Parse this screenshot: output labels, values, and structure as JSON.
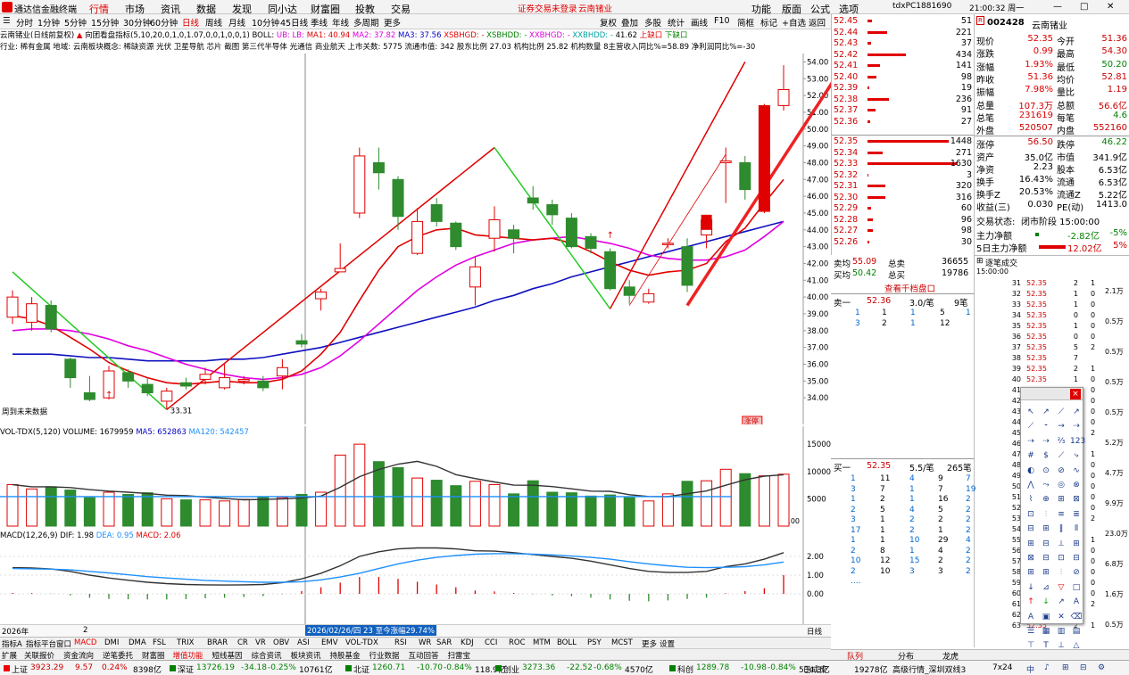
{
  "app": {
    "title": "通达信金融终端",
    "status_red": "证券交易未登录",
    "status_stock": "云南锗业",
    "user": "tdxPC1881690",
    "time": "21:00:32 周一"
  },
  "menu": [
    "行情",
    "市场",
    "资讯",
    "数据",
    "发现",
    "同小达",
    "财富圈",
    "投教",
    "交易"
  ],
  "right_menu": [
    "功能",
    "版面",
    "公式",
    "选项"
  ],
  "periods": [
    "分时",
    "1分钟",
    "5分钟",
    "15分钟",
    "30分钟",
    "60分钟",
    "日线",
    "周线",
    "月线",
    "10分钟",
    "45日线",
    "季线",
    "年线",
    "多周期",
    "更多"
  ],
  "period_tools": [
    "复权",
    "叠加",
    "多股",
    "统计",
    "画线",
    "F10",
    "简框",
    "标记",
    "+自选",
    "返回"
  ],
  "legend": {
    "main": "云南锗业(日线前复权)",
    "formula": "向团看盘指标(5,10,20,0,1,0,1.07,0,0,1,0,0,1)",
    "boll": "BOLL:",
    "ub": "UB:",
    "lb": "LB:",
    "ma1": "MA1: 40.94",
    "ma2": "MA2: 37.82",
    "ma3": "MA3: 37.56",
    "xsbhgd": "XSBHGD: -",
    "xsbhdd": "XSBHDD: -",
    "xxbhgd": "XXBHGD: -",
    "xxbhdd": "XXBHDD: -",
    "val": "41.62",
    "up": "上缺口",
    "down": "下缺口"
  },
  "industry_line": "行业: 稀有金属 地域: 云南板块概念: 稀缺资源 光伏 卫星导航 芯片 截图 第三代半导体 光通信 商业航天 上市关数: 5775 流通市值: 342 股东比例 27.03 机构比例 25.82 机构数量 8主营收入同比%=58.89 净利润同比%=-30",
  "price_axis": [
    "54.00",
    "53.00",
    "52.00",
    "51.00",
    "50.00",
    "49.00",
    "48.00",
    "47.00",
    "46.00",
    "45.00",
    "44.00",
    "43.00",
    "42.00",
    "41.00",
    "40.00",
    "39.00",
    "38.00",
    "37.00",
    "36.00",
    "35.00",
    "34.00"
  ],
  "price_labels": {
    "low": "33.31",
    "note": "周到未来数据",
    "tag": "涨停"
  },
  "vol": {
    "title": "VOL-TDX(5,120)",
    "volume": "VOLUME: 1679959",
    "ma5": "MA5: 652863",
    "ma120": "MA120: 542457",
    "unit": "X100",
    "axis": [
      "15000",
      "10000",
      "5000"
    ]
  },
  "macd": {
    "title": "MACD(12,26,9)",
    "dif": "DIF: 1.98",
    "dea": "DEA: 0.95",
    "macd": "MACD: 2.06",
    "axis": [
      "2.00",
      "1.00",
      "0.00"
    ]
  },
  "date_axis": {
    "year": "2026年",
    "m2": "2",
    "tip": "2026/02/26/四 23 至今涨幅29.74%",
    "tab": "日线"
  },
  "chart_data": {
    "type": "candlestick",
    "ylim": [
      33,
      54.5
    ],
    "candles": [
      {
        "o": 38.8,
        "c": 40.0,
        "h": 40.4,
        "l": 38.4
      },
      {
        "o": 38.5,
        "c": 39.6,
        "h": 40.0,
        "l": 38.0
      },
      {
        "o": 39.5,
        "c": 38.1,
        "h": 39.8,
        "l": 37.9
      },
      {
        "o": 36.3,
        "c": 35.2,
        "h": 36.4,
        "l": 34.6
      },
      {
        "o": 34.3,
        "c": 33.9,
        "h": 35.3,
        "l": 33.8
      },
      {
        "o": 34.0,
        "c": 35.6,
        "h": 35.9,
        "l": 33.9
      },
      {
        "o": 35.5,
        "c": 35.0,
        "h": 35.7,
        "l": 34.6
      },
      {
        "o": 34.8,
        "c": 34.3,
        "h": 35.2,
        "l": 34.1
      },
      {
        "o": 33.8,
        "c": 34.4,
        "h": 34.6,
        "l": 33.3
      },
      {
        "o": 34.9,
        "c": 34.7,
        "h": 35.2,
        "l": 34.5
      },
      {
        "o": 35.1,
        "c": 35.4,
        "h": 35.8,
        "l": 34.8
      },
      {
        "o": 34.6,
        "c": 35.2,
        "h": 36.0,
        "l": 34.5
      },
      {
        "o": 35.0,
        "c": 35.1,
        "h": 35.3,
        "l": 34.8
      },
      {
        "o": 35.0,
        "c": 34.6,
        "h": 35.3,
        "l": 34.4
      },
      {
        "o": 35.3,
        "c": 35.8,
        "h": 36.3,
        "l": 34.5
      },
      {
        "o": 37.4,
        "c": 37.2,
        "h": 37.8,
        "l": 37.0
      },
      {
        "o": 39.9,
        "c": 40.3,
        "h": 40.5,
        "l": 39.2
      },
      {
        "o": 41.5,
        "c": 41.7,
        "h": 43.2,
        "l": 41.5
      },
      {
        "o": 45.0,
        "c": 48.4,
        "h": 48.9,
        "l": 44.7
      },
      {
        "o": 48.0,
        "c": 47.4,
        "h": 48.9,
        "l": 46.4
      },
      {
        "o": 47.0,
        "c": 44.8,
        "h": 47.2,
        "l": 44.0
      },
      {
        "o": 42.6,
        "c": 44.5,
        "h": 45.3,
        "l": 42.5
      },
      {
        "o": 45.5,
        "c": 44.5,
        "h": 45.9,
        "l": 44.2
      },
      {
        "o": 44.4,
        "c": 43.0,
        "h": 44.5,
        "l": 42.8
      },
      {
        "o": 40.6,
        "c": 41.8,
        "h": 42.4,
        "l": 39.5
      },
      {
        "o": 43.5,
        "c": 44.6,
        "h": 45.4,
        "l": 42.7
      },
      {
        "o": 44.0,
        "c": 43.5,
        "h": 44.3,
        "l": 42.6
      },
      {
        "o": 45.9,
        "c": 45.6,
        "h": 46.6,
        "l": 45.2
      },
      {
        "o": 45.5,
        "c": 44.9,
        "h": 45.8,
        "l": 44.3
      },
      {
        "o": 44.7,
        "c": 43.0,
        "h": 45.0,
        "l": 42.9
      },
      {
        "o": 43.6,
        "c": 42.9,
        "h": 43.8,
        "l": 42.6
      },
      {
        "o": 42.7,
        "c": 40.5,
        "h": 42.9,
        "l": 40.4
      },
      {
        "o": 40.6,
        "c": 40.1,
        "h": 41.0,
        "l": 39.6
      },
      {
        "o": 39.7,
        "c": 40.2,
        "h": 40.5,
        "l": 39.6
      },
      {
        "o": 43.2,
        "c": 43.2,
        "h": 43.5,
        "l": 42.9
      },
      {
        "o": 43.0,
        "c": 40.7,
        "h": 43.5,
        "l": 40.3
      },
      {
        "o": 43.7,
        "c": 44.6,
        "h": 44.9,
        "l": 42.9
      },
      {
        "o": 48.0,
        "c": 48.1,
        "h": 48.9,
        "l": 45.6
      },
      {
        "o": 48.0,
        "c": 46.4,
        "h": 48.4,
        "l": 45.8
      },
      {
        "o": 45.1,
        "c": 51.4,
        "h": 51.5,
        "l": 45.0
      },
      {
        "o": 51.4,
        "c": 52.35,
        "h": 53.8,
        "l": 51.1
      }
    ],
    "ma1": [
      38.9,
      38.7,
      38.3,
      37.6,
      36.9,
      36.1,
      35.6,
      35.2,
      34.9,
      34.8,
      34.9,
      35.0,
      34.9,
      34.9,
      35.1,
      35.6,
      36.6,
      37.9,
      39.8,
      41.6,
      43.0,
      43.6,
      44.0,
      44.1,
      43.7,
      43.6,
      43.5,
      43.4,
      43.5,
      43.2,
      42.7,
      42.1,
      41.6,
      41.3,
      41.5,
      41.6,
      42.0,
      43.3,
      44.1,
      45.6,
      47.0
    ],
    "ma2": [
      38.0,
      38.1,
      38.1,
      38.0,
      37.8,
      37.5,
      37.1,
      36.8,
      36.4,
      36.0,
      35.7,
      35.4,
      35.2,
      35.1,
      35.2,
      35.4,
      35.8,
      36.5,
      37.4,
      38.4,
      39.4,
      40.4,
      41.2,
      41.9,
      42.4,
      42.8,
      43.2,
      43.4,
      43.5,
      43.6,
      43.4,
      43.2,
      42.9,
      42.5,
      42.3,
      42.2,
      42.2,
      42.4,
      42.8,
      43.6,
      44.5
    ],
    "ma3": [
      36.6,
      36.6,
      36.6,
      36.5,
      36.4,
      36.4,
      36.3,
      36.2,
      36.2,
      36.2,
      36.2,
      36.3,
      36.3,
      36.4,
      36.6,
      36.8,
      37.0,
      37.3,
      37.6,
      37.9,
      38.2,
      38.5,
      38.8,
      39.1,
      39.4,
      39.8,
      40.1,
      40.5,
      40.8,
      41.2,
      41.5,
      41.8,
      42.1,
      42.4,
      42.7,
      43.0,
      43.3,
      43.6,
      43.9,
      44.2,
      44.5
    ],
    "volumes": [
      7600,
      6800,
      7200,
      6600,
      5200,
      6200,
      5800,
      6100,
      5000,
      4800,
      4800,
      4600,
      4900,
      5300,
      5200,
      5800,
      6200,
      13000,
      15000,
      11800,
      10700,
      8800,
      8400,
      7400,
      8200,
      7600,
      5900,
      8300,
      6200,
      6100,
      5500,
      5700,
      5200,
      4600,
      5900,
      8200,
      8300,
      10400,
      9600,
      9200,
      9500
    ],
    "macd_dif": [
      1.4,
      1.38,
      1.33,
      1.2,
      1.0,
      0.85,
      0.73,
      0.62,
      0.55,
      0.5,
      0.48,
      0.47,
      0.48,
      0.5,
      0.6,
      0.8,
      1.1,
      1.5,
      2.0,
      2.25,
      2.4,
      2.45,
      2.45,
      2.4,
      2.3,
      2.28,
      2.2,
      2.1,
      2.0,
      1.9,
      1.75,
      1.55,
      1.35,
      1.2,
      1.15,
      1.15,
      1.2,
      1.45,
      1.6,
      1.85,
      2.2
    ],
    "macd_dea": [
      1.35,
      1.34,
      1.32,
      1.28,
      1.2,
      1.12,
      1.02,
      0.92,
      0.85,
      0.78,
      0.72,
      0.68,
      0.65,
      0.62,
      0.62,
      0.65,
      0.75,
      0.9,
      1.1,
      1.35,
      1.6,
      1.8,
      1.95,
      2.05,
      2.12,
      2.15,
      2.15,
      2.12,
      2.08,
      2.02,
      1.95,
      1.85,
      1.72,
      1.6,
      1.5,
      1.42,
      1.4,
      1.42,
      1.45,
      1.55,
      1.7
    ],
    "macd_hist": [
      0.05,
      0.04,
      0.01,
      -0.08,
      -0.2,
      -0.27,
      -0.29,
      -0.3,
      -0.3,
      -0.28,
      -0.24,
      -0.21,
      -0.17,
      -0.12,
      -0.02,
      0.15,
      0.35,
      0.6,
      0.9,
      0.9,
      0.8,
      0.65,
      0.5,
      0.35,
      0.18,
      0.13,
      0.05,
      -0.02,
      -0.08,
      -0.12,
      -0.2,
      -0.3,
      -0.37,
      -0.4,
      -0.35,
      -0.27,
      -0.2,
      0.03,
      0.15,
      0.3,
      1.0
    ]
  },
  "order_book": {
    "asks": [
      [
        "52.45",
        "51"
      ],
      [
        "52.44",
        "221"
      ],
      [
        "52.43",
        "37"
      ],
      [
        "52.42",
        "434"
      ],
      [
        "52.41",
        "141"
      ],
      [
        "52.40",
        "98"
      ],
      [
        "52.39",
        "19"
      ],
      [
        "52.38",
        "236"
      ],
      [
        "52.37",
        "91"
      ],
      [
        "52.36",
        "27"
      ]
    ],
    "bids": [
      [
        "52.35",
        "1448"
      ],
      [
        "52.34",
        "271"
      ],
      [
        "52.33",
        "1630"
      ],
      [
        "52.32",
        "3"
      ],
      [
        "52.31",
        "320"
      ],
      [
        "52.30",
        "316"
      ],
      [
        "52.29",
        "60"
      ],
      [
        "52.28",
        "96"
      ],
      [
        "52.27",
        "98"
      ],
      [
        "52.26",
        "30"
      ]
    ]
  },
  "stock": {
    "code": "002428",
    "name": "云南锗业",
    "badge": "R"
  },
  "stats": [
    [
      "现价",
      "52.35",
      "今开",
      "51.36"
    ],
    [
      "涨跌",
      "0.99",
      "最高",
      "54.30"
    ],
    [
      "涨幅",
      "1.93%",
      "最低",
      "50.20"
    ],
    [
      "昨收",
      "51.36",
      "均价",
      "52.81"
    ],
    [
      "振幅",
      "7.98%",
      "量比",
      "1.19"
    ],
    [
      "总量",
      "107.3万",
      "总额",
      "56.6亿"
    ],
    [
      "总笔",
      "231619",
      "每笔",
      "4.6"
    ],
    [
      "外盘",
      "520507",
      "内盘",
      "552160"
    ]
  ],
  "stats2": [
    [
      "涨停",
      "56.50",
      "跌停",
      "46.22"
    ],
    [
      "资产",
      "35.0亿",
      "市值",
      "341.9亿"
    ],
    [
      "净资",
      "2.23",
      "股本",
      "6.53亿"
    ],
    [
      "换手",
      "16.43%",
      "流通",
      "6.53亿"
    ],
    [
      "换手Z",
      "20.53%",
      "流通Z",
      "5.22亿"
    ],
    [
      "收益(三)",
      "0.030",
      "PE(动)",
      "1413.0"
    ]
  ],
  "trade_state": {
    "label": "交易状态:",
    "value": "闭市阶段 15:00:00"
  },
  "flow": [
    [
      "主力净额",
      "-2.82亿",
      "-5%"
    ],
    [
      "5日主力净额",
      "12.02亿",
      "5%"
    ]
  ],
  "mid": {
    "avg_sell_label": "卖均",
    "avg_sell": "55.09",
    "total_sell_label": "总卖",
    "total_sell": "36655",
    "avg_buy_label": "买均",
    "avg_buy": "50.42",
    "total_buy_label": "总买",
    "total_buy": "19786",
    "link": "查看千档盘口",
    "sell1": {
      "label": "卖一",
      "price": "52.36",
      "qty": "3.0/笔",
      "n": "9笔"
    },
    "sell1_rows": [
      [
        "1",
        "1",
        "1",
        "5",
        "1"
      ],
      [
        "3",
        "2",
        "1",
        "12",
        ""
      ]
    ],
    "buy1": {
      "label": "买一",
      "price": "52.35",
      "qty": "5.5/笔",
      "n": "265笔"
    },
    "buy1_rows": [
      [
        "1",
        "11",
        "4",
        "9",
        "7"
      ],
      [
        "3",
        "7",
        "1",
        "7",
        "19"
      ],
      [
        "1",
        "2",
        "1",
        "16",
        "2"
      ],
      [
        "2",
        "5",
        "4",
        "5",
        "2"
      ],
      [
        "3",
        "1",
        "2",
        "2",
        "2"
      ],
      [
        "17",
        "1",
        "2",
        "1",
        "2"
      ],
      [
        "1",
        "1",
        "10",
        "29",
        "4"
      ],
      [
        "2",
        "8",
        "1",
        "4",
        "2"
      ],
      [
        "10",
        "12",
        "15",
        "2",
        "2"
      ],
      [
        "2",
        "10",
        "3",
        "3",
        "2"
      ],
      [
        "....",
        "",
        "",
        "",
        ""
      ]
    ]
  },
  "trade_list": {
    "title": "逐笔成交",
    "first_time": "15:00:00",
    "rows": [
      [
        "52.35",
        "2",
        "1"
      ],
      [
        "52.35",
        "1",
        "0"
      ],
      [
        "52.35",
        "1",
        "0"
      ],
      [
        "52.35",
        "0",
        "0"
      ],
      [
        "52.35",
        "1",
        "0"
      ],
      [
        "52.35",
        "0",
        "0"
      ],
      [
        "52.35",
        "5",
        "2"
      ],
      [
        "52.35",
        "7",
        ""
      ]
    ],
    "right_vals": [
      "2.1万",
      "0.5万",
      "0.5万",
      "0.5万",
      "0.5万",
      "5.2万",
      "4.7万",
      "9.9万",
      "23.0万",
      "6.8万",
      "1.6万",
      "0.5万"
    ],
    "seq": [
      "31",
      "32",
      "33",
      "34",
      "35",
      "36",
      "37",
      "38",
      "39",
      "40",
      "41",
      "42",
      "43",
      "44",
      "45",
      "46",
      "47",
      "48",
      "49",
      "50",
      "51",
      "52",
      "53",
      "54",
      "55",
      "56",
      "57",
      "58",
      "59",
      "60",
      "61",
      "62",
      "63",
      "64",
      "65"
    ]
  },
  "right_tabs": [
    "队列",
    "分布",
    "龙虎"
  ],
  "bottom_tabs": [
    "指标A",
    "指标平台",
    "窗口",
    "MACD",
    "DMI",
    "DMA",
    "FSL",
    "TRIX",
    "BRAR",
    "CR",
    "VR",
    "OBV",
    "ASI",
    "EMV",
    "VOL-TDX",
    "RSI",
    "WR",
    "SAR",
    "KDJ",
    "CCI",
    "ROC",
    "MTM",
    "BOLL",
    "PSY",
    "MCST",
    "更多",
    "设置"
  ],
  "bottom_tabs2": [
    "扩展",
    "关联报价",
    "资金流向",
    "逆笔委托",
    "财富圈",
    "增值功能",
    "短线基因",
    "综合资讯",
    "板块资讯",
    "持股基金",
    "行业数据",
    "互动回答",
    "扫雷宝"
  ],
  "status_bar": [
    {
      "n": "上证",
      "v": "3923.29",
      "c": "9.57",
      "p": "0.24%",
      "a": "8398亿"
    },
    {
      "n": "深证",
      "v": "13726.19",
      "c": "-34.18",
      "p": "-0.25%",
      "a": "10761亿"
    },
    {
      "n": "北证",
      "v": "1260.71",
      "c": "-10.70",
      "p": "-0.84%",
      "a": "118.9亿"
    },
    {
      "n": "创业",
      "v": "3273.36",
      "c": "-22.52",
      "p": "-0.68%",
      "a": "4570亿"
    },
    {
      "n": "科创",
      "v": "1289.78",
      "c": "-10.98",
      "p": "-0.84%",
      "a": "534.3亿"
    }
  ],
  "status_right": {
    "done": "已成交",
    "amt": "19278亿",
    "mkt": "高级行情_深圳双线3",
    "speed": "7x24"
  },
  "colors": {
    "up": "#e00000",
    "down": "#2e8b2e",
    "ma1": "#e00000",
    "ma2": "#e000e0",
    "ma3": "#1010c0",
    "dif": "#333333",
    "dea": "#1e90ff"
  }
}
